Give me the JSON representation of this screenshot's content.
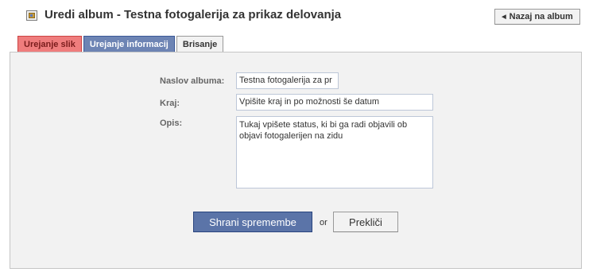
{
  "header": {
    "title": "Uredi album - Testna fotogalerija za prikaz delovanja",
    "back_label": "Nazaj na album",
    "icon": "album-icon"
  },
  "tabs": [
    {
      "label": "Urejanje slik",
      "state": "active"
    },
    {
      "label": "Urejanje informacij",
      "state": "selected"
    },
    {
      "label": "Brisanje",
      "state": "normal"
    }
  ],
  "form": {
    "name_label": "Naslov albuma:",
    "name_value": "Testna fotogalerija za pr",
    "location_label": "Kraj:",
    "location_value": "Vpišite kraj in po možnosti še datum",
    "desc_label": "Opis:",
    "desc_value": "Tukaj vpišete status, ki bi ga radi objavili ob objavi fotogalerijen na zidu",
    "save_label": "Shrani spremembe",
    "or_label": "or",
    "cancel_label": "Prekliči"
  },
  "colors": {
    "active_tab": "#ef7d7d",
    "selected_tab": "#6d84b4",
    "primary_button": "#5b74a8",
    "panel_bg": "#f2f2f2"
  }
}
